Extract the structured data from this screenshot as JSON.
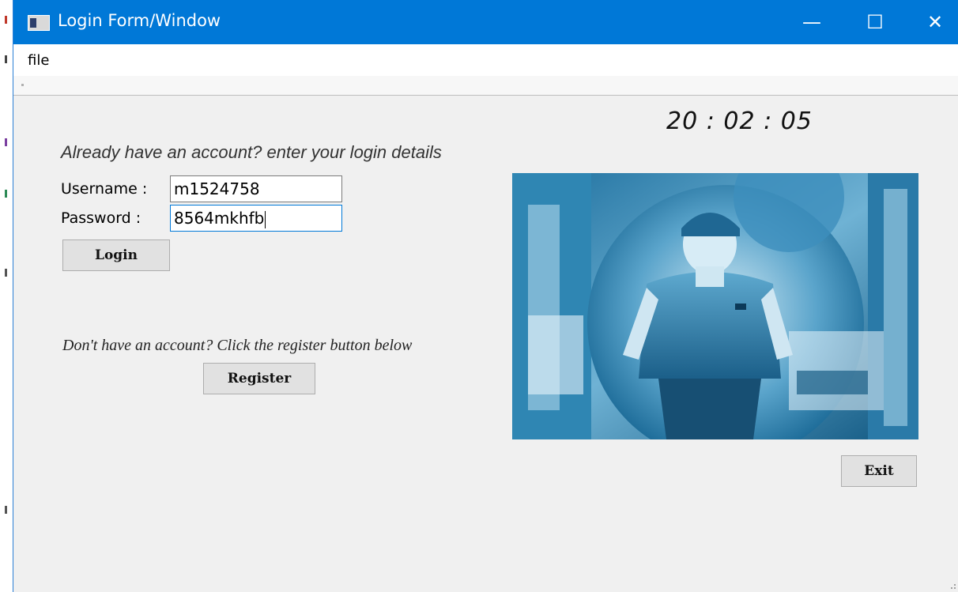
{
  "window": {
    "title": "Login Form/Window",
    "controls": {
      "minimize": "—",
      "maximize": "☐",
      "close": "✕"
    }
  },
  "menubar": {
    "file_label": "file"
  },
  "clock": {
    "time": "20 : 02 : 05"
  },
  "login": {
    "heading": "Already have an account? enter your login details",
    "username_label": "Username :",
    "username_value": "m1524758",
    "password_label": "Password :",
    "password_value": "8564mkhfb",
    "login_button": "Login"
  },
  "register": {
    "prompt": "Don't have an account? Click the register button below",
    "register_button": "Register"
  },
  "exit_button": "Exit",
  "colors": {
    "titlebar": "#0078d7",
    "window_bg": "#f0f0f0",
    "photo_tint": "#4a97c0"
  },
  "icons": [
    "app-icon",
    "minimize-icon",
    "maximize-icon",
    "close-icon"
  ]
}
